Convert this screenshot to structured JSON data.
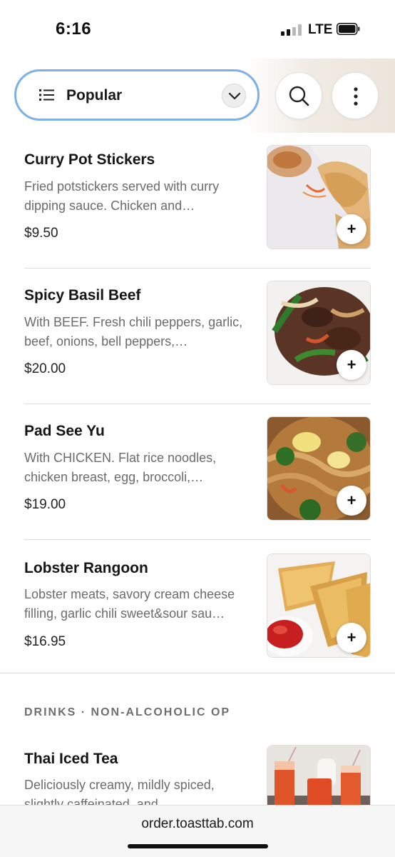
{
  "status_bar": {
    "time": "6:16",
    "network": "LTE"
  },
  "header": {
    "menu_select_label": "Popular",
    "icons": [
      "list-icon",
      "chevron-down-icon",
      "search-icon",
      "more-vertical-icon"
    ]
  },
  "items": [
    {
      "name": "Curry Pot Stickers",
      "description": "Fried potstickers served with curry dipping sauce. Chicken and…",
      "price": "$9.50",
      "add_label": "+"
    },
    {
      "name": "Spicy Basil Beef",
      "description": "With BEEF. Fresh chili peppers, garlic, beef, onions, bell peppers,…",
      "price": "$20.00",
      "add_label": "+"
    },
    {
      "name": "Pad See Yu",
      "description": "With CHICKEN. Flat rice noodles, chicken breast, egg, broccoli,…",
      "price": "$19.00",
      "add_label": "+"
    },
    {
      "name": "Lobster Rangoon",
      "description": "Lobster meats, savory cream cheese filling, garlic chili sweet&sour sau…",
      "price": "$16.95",
      "add_label": "+"
    }
  ],
  "section": {
    "title": "DRINKS · NON-ALCOHOLIC OP"
  },
  "drink": {
    "name": "Thai Iced Tea",
    "description": "Deliciously creamy, mildly spiced, slightly caffeinated, and"
  },
  "browser": {
    "url": "order.toasttab.com"
  },
  "colors": {
    "select_border": "#7fb0e6",
    "text_muted": "#6b6b6b"
  }
}
